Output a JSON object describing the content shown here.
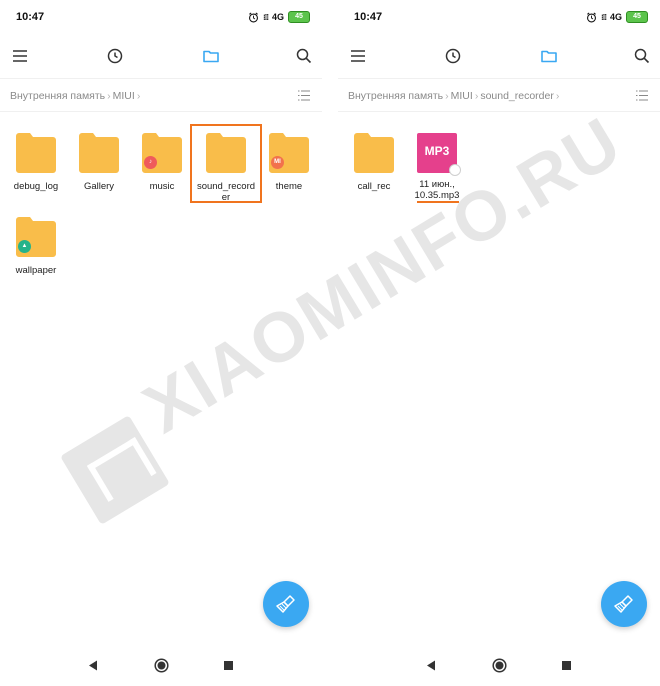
{
  "colors": {
    "accent": "#3aa8f2",
    "folder": "#f9bd4a",
    "highlight": "#f0741e",
    "mp3": "#e5408c",
    "battery": "#5cc44c"
  },
  "watermark": {
    "text": "XIAOMINFO.RU"
  },
  "left": {
    "status": {
      "time": "10:47",
      "network": "4G",
      "battery": "45"
    },
    "toolbar": {
      "icons": [
        "menu-icon",
        "history-icon",
        "folder-icon",
        "search-icon"
      ]
    },
    "breadcrumb": {
      "part1": "Внутренняя память",
      "part2": "MIUI"
    },
    "folders": [
      {
        "name": "debug_log",
        "badge": ""
      },
      {
        "name": "Gallery",
        "badge": ""
      },
      {
        "name": "music",
        "badge": "♪"
      },
      {
        "name": "sound_recorder",
        "badge": ""
      },
      {
        "name": "theme",
        "badge": "MI"
      },
      {
        "name": "wallpaper",
        "badge": "▲"
      }
    ]
  },
  "right": {
    "status": {
      "time": "10:47",
      "network": "4G",
      "battery": "45"
    },
    "breadcrumb": {
      "part1": "Внутренняя память",
      "part2": "MIUI",
      "part3": "sound_recorder"
    },
    "folders": [
      {
        "name": "call_rec"
      }
    ],
    "file": {
      "type_label": "MP3",
      "name_line1": "11 июн.,",
      "name_line2": "10.35.mp3"
    }
  },
  "nav": {
    "icons": [
      "back-icon",
      "home-icon",
      "recents-icon"
    ]
  }
}
